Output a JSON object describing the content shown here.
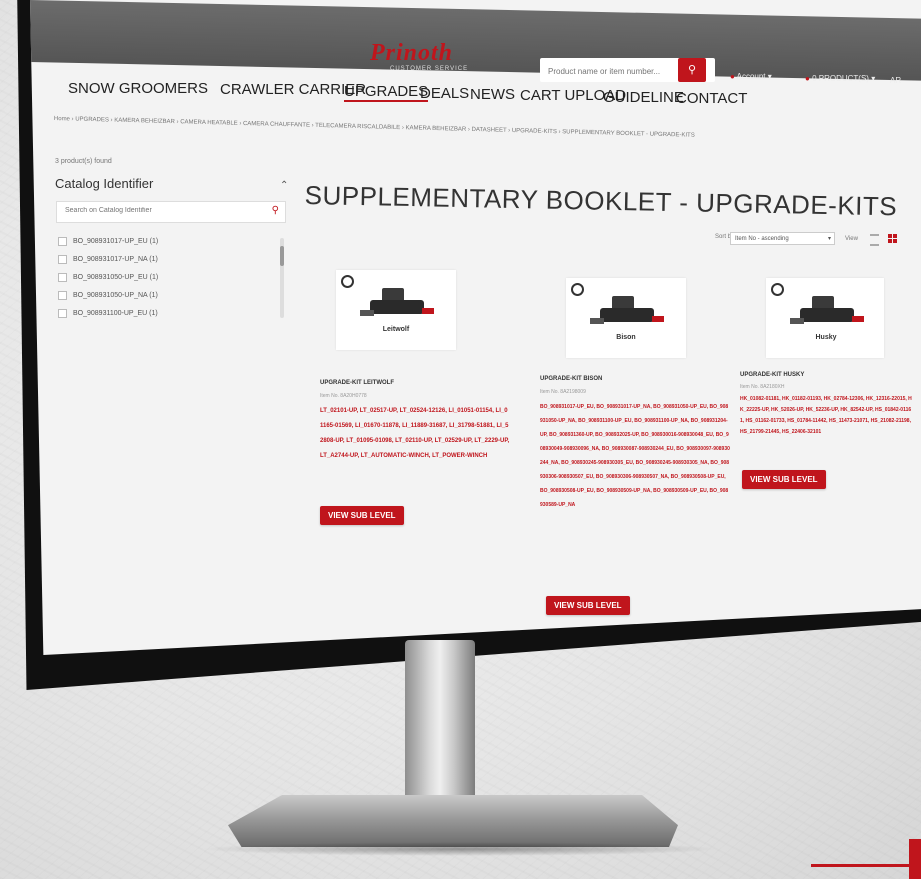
{
  "brand": {
    "logo": "Prinoth",
    "tagline": "CUSTOMER SERVICE",
    "accent": "#c0151c"
  },
  "header": {
    "search_placeholder": "Product name or item number...",
    "account": "Account",
    "products": "0 PRODUCT(S)",
    "user": "AR"
  },
  "nav": {
    "items": [
      "SNOW GROOMERS",
      "CRAWLER CARRIER",
      "UPGRADES",
      "DEALS",
      "NEWS",
      "CART UPLOAD",
      "GUIDELINE",
      "CONTACT"
    ],
    "active": "UPGRADES"
  },
  "breadcrumb": "Home › UPGRADES › KAMERA BEHEIZBAR › CAMERA HEATABLE › CAMERA CHAUFFANTE › TELECAMERA RISCALDABILE › KAMERA BEHEIZBAR › DATASHEET › UPGRADE-KITS › SUPPLEMENTARY BOOKLET - UPGRADE-KITS",
  "sidebar": {
    "count": "3 product(s) found",
    "title": "Catalog Identifier",
    "search_placeholder": "Search on Catalog Identifier",
    "items": [
      "BO_908931017-UP_EU (1)",
      "BO_908931017-UP_NA (1)",
      "BO_908931050-UP_EU (1)",
      "BO_908931050-UP_NA (1)",
      "BO_908931100-UP_EU (1)"
    ]
  },
  "main": {
    "title": "SUPPLEMENTARY BOOKLET - UPGRADE-KITS",
    "sort_label": "Sort by",
    "sort_value": "Item No - ascending",
    "view_label": "View"
  },
  "products": [
    {
      "image_label": "Leitwolf",
      "name": "UPGRADE-KIT LEITWOLF",
      "item_no": "Item No. 8A20H0778",
      "codes": "LT_02101-UP, LT_02517-UP, LT_02524-12126, LI_01051-01154, LI_01165-01569, LI_01670-11878, LI_11889-31687, LI_31798-51881, LI_52808-UP, LT_01095-01098, LT_02110-UP, LT_02529-UP, LT_2229-UP, LT_A2744-UP, LT_AUTOMATIC-WINCH, LT_POWER-WINCH",
      "button": "VIEW SUB LEVEL"
    },
    {
      "image_label": "Bison",
      "name": "UPGRADE-KIT BISON",
      "item_no": "Item No. 8A2198009",
      "codes": "BO_908931017-UP_EU, BO_908931017-UP_NA, BO_908931050-UP_EU, BO_908931050-UP_NA, BO_908931100-UP_EU, BO_908931100-UP_NA, BO_908931204-UP, BO_908931360-UP, BO_908932025-UP, BO_908930016-908930048_EU, BO_908930049-908930096_NA, BO_908930087-908930244_EU, BO_908930097-908930244_NA, BO_908930245-908930305_EU, BO_908930245-908930305_NA, BO_908930306-908930507_EU, BO_908930306-908930507_NA, BO_908930508-UP_EU, BO_908930508-UP_EU, BO_908930509-UP_NA, BO_908930509-UP_EU, BO_908930589-UP_NA",
      "button": "VIEW SUB LEVEL"
    },
    {
      "image_label": "Husky",
      "name": "UPGRADE-KIT HUSKY",
      "item_no": "Item No. 8A2180XH",
      "codes": "HK_01082-01181, HK_01182-01193, HK_02784-12306, HK_12316-22015, HK_22225-UP, HK_52026-UP, HK_52236-UP, HK_82542-UP, HS_01842-01161, HS_01162-01733, HS_01784-11442, HS_11473-21071, HS_21082-21198, HS_21799-21445, HS_22406-32101",
      "button": "VIEW SUB LEVEL"
    }
  ]
}
